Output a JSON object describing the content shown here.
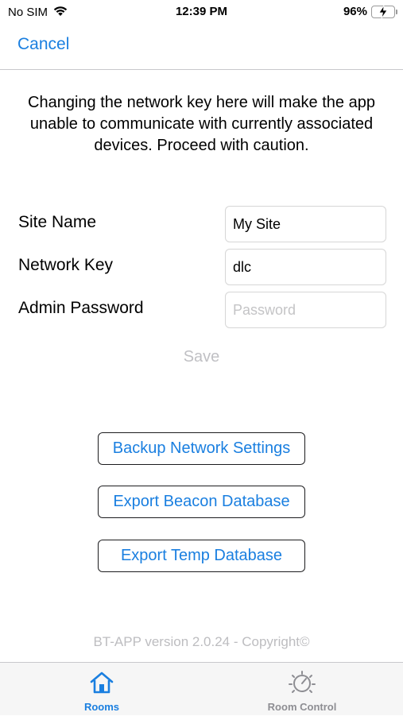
{
  "status_bar": {
    "carrier": "No SIM",
    "time": "12:39 PM",
    "battery_percent": "96%",
    "battery_level": 0.96,
    "charging": true
  },
  "nav": {
    "cancel_label": "Cancel"
  },
  "warning": {
    "text": "Changing the network key here will make the app unable to communicate with currently associated devices. Proceed with caution."
  },
  "form": {
    "site_name": {
      "label": "Site Name",
      "value": "My Site",
      "placeholder": ""
    },
    "network_key": {
      "label": "Network Key",
      "value": "dlc",
      "placeholder": ""
    },
    "admin_password": {
      "label": "Admin Password",
      "value": "",
      "placeholder": "Password"
    },
    "save_label": "Save"
  },
  "actions": {
    "backup_label": "Backup Network Settings",
    "export_beacon_label": "Export Beacon Database",
    "export_temp_label": "Export Temp Database"
  },
  "footer": {
    "version_text": "BT-APP version 2.0.24 - Copyright©"
  },
  "tab_bar": {
    "tabs": [
      {
        "label": "Rooms",
        "icon": "house-icon",
        "active": true
      },
      {
        "label": "Room Control",
        "icon": "dial-icon",
        "active": false
      }
    ]
  },
  "colors": {
    "accent": "#1a7fe0",
    "disabled": "#c0c0c4",
    "battery_fill": "#34c759",
    "tab_inactive": "#8e8e93"
  }
}
